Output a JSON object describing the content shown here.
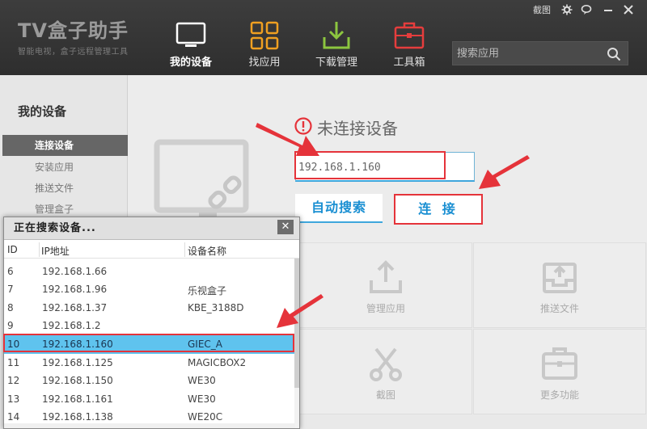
{
  "app": {
    "logo_name": "TV盒子助手",
    "logo_subtitle": "智能电视，盒子远程管理工具"
  },
  "window_controls": {
    "screenshot_label": "截图"
  },
  "nav": [
    {
      "label": "我的设备",
      "icon": "tv-icon",
      "active": true
    },
    {
      "label": "找应用",
      "icon": "grid-icon",
      "active": false
    },
    {
      "label": "下载管理",
      "icon": "download-icon",
      "active": false
    },
    {
      "label": "工具箱",
      "icon": "toolbox-icon",
      "active": false
    }
  ],
  "search": {
    "placeholder": "搜索应用"
  },
  "sidebar": {
    "heading": "我的设备",
    "items": [
      {
        "label": "连接设备",
        "active": true
      },
      {
        "label": "安装应用",
        "active": false
      },
      {
        "label": "推送文件",
        "active": false
      },
      {
        "label": "管理盒子",
        "active": false
      }
    ]
  },
  "main": {
    "status_text": "未连接设备",
    "ip_value": "192.168.1.160",
    "auto_search_label": "自动搜索",
    "connect_label": "连 接",
    "tiles": [
      {
        "label": "管理应用",
        "icon": "upload-icon"
      },
      {
        "label": "推送文件",
        "icon": "inbox-icon"
      },
      {
        "label": "截图",
        "icon": "scissors-icon"
      },
      {
        "label": "更多功能",
        "icon": "toolbox-icon"
      }
    ]
  },
  "popup": {
    "title": "正在搜索设备...",
    "close_label": "✕",
    "columns": [
      "ID",
      "IP地址",
      "设备名称"
    ],
    "rows": [
      {
        "id": "6",
        "ip": "192.168.1.66",
        "name": ""
      },
      {
        "id": "7",
        "ip": "192.168.1.96",
        "name": "乐视盒子"
      },
      {
        "id": "8",
        "ip": "192.168.1.37",
        "name": "KBE_3188D"
      },
      {
        "id": "9",
        "ip": "192.168.1.2",
        "name": ""
      },
      {
        "id": "10",
        "ip": "192.168.1.160",
        "name": "GIEC_A",
        "selected": true
      },
      {
        "id": "11",
        "ip": "192.168.1.125",
        "name": "MAGICBOX2"
      },
      {
        "id": "12",
        "ip": "192.168.1.150",
        "name": "WE30"
      },
      {
        "id": "13",
        "ip": "192.168.1.161",
        "name": "WE30"
      },
      {
        "id": "14",
        "ip": "192.168.1.138",
        "name": "WE20C"
      }
    ]
  },
  "colors": {
    "accent_blue": "#1a8fd2",
    "highlight_red": "#e5333a",
    "selected_row": "#5fc3ee",
    "title_bar": "#363636"
  }
}
